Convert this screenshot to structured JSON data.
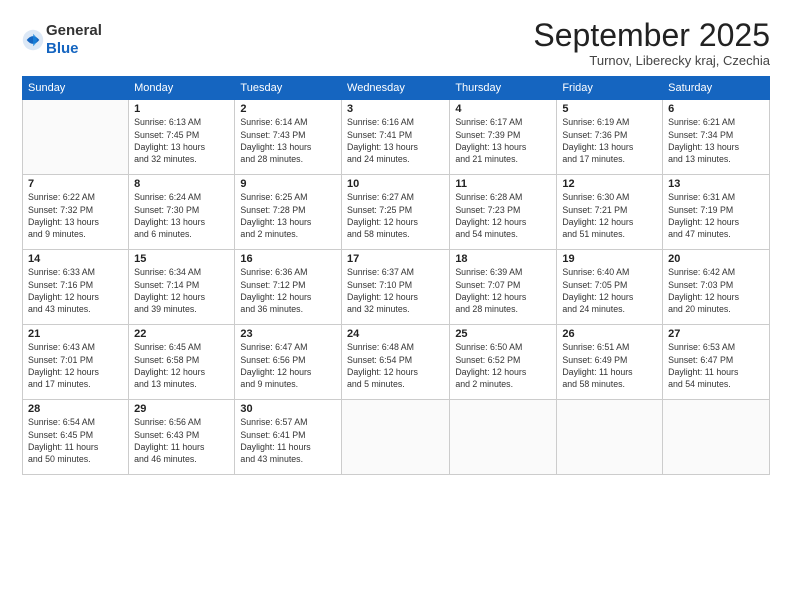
{
  "logo": {
    "general": "General",
    "blue": "Blue"
  },
  "header": {
    "month": "September 2025",
    "location": "Turnov, Liberecky kraj, Czechia"
  },
  "weekdays": [
    "Sunday",
    "Monday",
    "Tuesday",
    "Wednesday",
    "Thursday",
    "Friday",
    "Saturday"
  ],
  "weeks": [
    [
      {
        "day": "",
        "info": ""
      },
      {
        "day": "1",
        "info": "Sunrise: 6:13 AM\nSunset: 7:45 PM\nDaylight: 13 hours\nand 32 minutes."
      },
      {
        "day": "2",
        "info": "Sunrise: 6:14 AM\nSunset: 7:43 PM\nDaylight: 13 hours\nand 28 minutes."
      },
      {
        "day": "3",
        "info": "Sunrise: 6:16 AM\nSunset: 7:41 PM\nDaylight: 13 hours\nand 24 minutes."
      },
      {
        "day": "4",
        "info": "Sunrise: 6:17 AM\nSunset: 7:39 PM\nDaylight: 13 hours\nand 21 minutes."
      },
      {
        "day": "5",
        "info": "Sunrise: 6:19 AM\nSunset: 7:36 PM\nDaylight: 13 hours\nand 17 minutes."
      },
      {
        "day": "6",
        "info": "Sunrise: 6:21 AM\nSunset: 7:34 PM\nDaylight: 13 hours\nand 13 minutes."
      }
    ],
    [
      {
        "day": "7",
        "info": "Sunrise: 6:22 AM\nSunset: 7:32 PM\nDaylight: 13 hours\nand 9 minutes."
      },
      {
        "day": "8",
        "info": "Sunrise: 6:24 AM\nSunset: 7:30 PM\nDaylight: 13 hours\nand 6 minutes."
      },
      {
        "day": "9",
        "info": "Sunrise: 6:25 AM\nSunset: 7:28 PM\nDaylight: 13 hours\nand 2 minutes."
      },
      {
        "day": "10",
        "info": "Sunrise: 6:27 AM\nSunset: 7:25 PM\nDaylight: 12 hours\nand 58 minutes."
      },
      {
        "day": "11",
        "info": "Sunrise: 6:28 AM\nSunset: 7:23 PM\nDaylight: 12 hours\nand 54 minutes."
      },
      {
        "day": "12",
        "info": "Sunrise: 6:30 AM\nSunset: 7:21 PM\nDaylight: 12 hours\nand 51 minutes."
      },
      {
        "day": "13",
        "info": "Sunrise: 6:31 AM\nSunset: 7:19 PM\nDaylight: 12 hours\nand 47 minutes."
      }
    ],
    [
      {
        "day": "14",
        "info": "Sunrise: 6:33 AM\nSunset: 7:16 PM\nDaylight: 12 hours\nand 43 minutes."
      },
      {
        "day": "15",
        "info": "Sunrise: 6:34 AM\nSunset: 7:14 PM\nDaylight: 12 hours\nand 39 minutes."
      },
      {
        "day": "16",
        "info": "Sunrise: 6:36 AM\nSunset: 7:12 PM\nDaylight: 12 hours\nand 36 minutes."
      },
      {
        "day": "17",
        "info": "Sunrise: 6:37 AM\nSunset: 7:10 PM\nDaylight: 12 hours\nand 32 minutes."
      },
      {
        "day": "18",
        "info": "Sunrise: 6:39 AM\nSunset: 7:07 PM\nDaylight: 12 hours\nand 28 minutes."
      },
      {
        "day": "19",
        "info": "Sunrise: 6:40 AM\nSunset: 7:05 PM\nDaylight: 12 hours\nand 24 minutes."
      },
      {
        "day": "20",
        "info": "Sunrise: 6:42 AM\nSunset: 7:03 PM\nDaylight: 12 hours\nand 20 minutes."
      }
    ],
    [
      {
        "day": "21",
        "info": "Sunrise: 6:43 AM\nSunset: 7:01 PM\nDaylight: 12 hours\nand 17 minutes."
      },
      {
        "day": "22",
        "info": "Sunrise: 6:45 AM\nSunset: 6:58 PM\nDaylight: 12 hours\nand 13 minutes."
      },
      {
        "day": "23",
        "info": "Sunrise: 6:47 AM\nSunset: 6:56 PM\nDaylight: 12 hours\nand 9 minutes."
      },
      {
        "day": "24",
        "info": "Sunrise: 6:48 AM\nSunset: 6:54 PM\nDaylight: 12 hours\nand 5 minutes."
      },
      {
        "day": "25",
        "info": "Sunrise: 6:50 AM\nSunset: 6:52 PM\nDaylight: 12 hours\nand 2 minutes."
      },
      {
        "day": "26",
        "info": "Sunrise: 6:51 AM\nSunset: 6:49 PM\nDaylight: 11 hours\nand 58 minutes."
      },
      {
        "day": "27",
        "info": "Sunrise: 6:53 AM\nSunset: 6:47 PM\nDaylight: 11 hours\nand 54 minutes."
      }
    ],
    [
      {
        "day": "28",
        "info": "Sunrise: 6:54 AM\nSunset: 6:45 PM\nDaylight: 11 hours\nand 50 minutes."
      },
      {
        "day": "29",
        "info": "Sunrise: 6:56 AM\nSunset: 6:43 PM\nDaylight: 11 hours\nand 46 minutes."
      },
      {
        "day": "30",
        "info": "Sunrise: 6:57 AM\nSunset: 6:41 PM\nDaylight: 11 hours\nand 43 minutes."
      },
      {
        "day": "",
        "info": ""
      },
      {
        "day": "",
        "info": ""
      },
      {
        "day": "",
        "info": ""
      },
      {
        "day": "",
        "info": ""
      }
    ]
  ]
}
